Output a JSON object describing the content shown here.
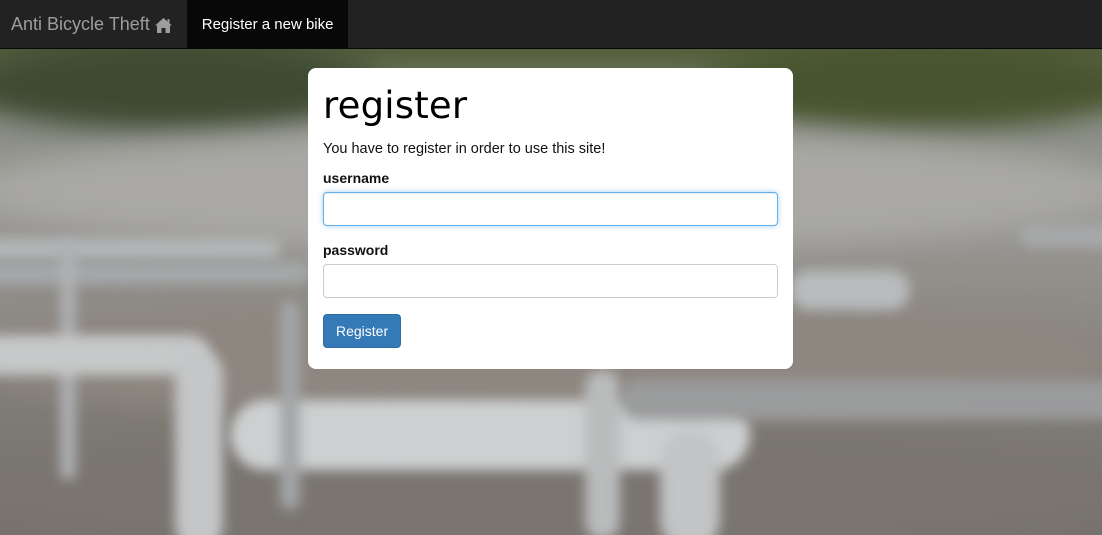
{
  "navbar": {
    "brand": "Anti Bicycle Theft",
    "brand_icon": "home-icon",
    "active_item": "Register a new bike"
  },
  "form": {
    "title": "register",
    "intro": "You have to register in order to use this site!",
    "username_label": "username",
    "username_value": "",
    "password_label": "password",
    "password_value": "",
    "submit_label": "Register"
  },
  "colors": {
    "navbar_bg": "#222222",
    "active_nav_bg": "#080808",
    "primary_button": "#337ab7",
    "focus_border": "#66afe9"
  }
}
